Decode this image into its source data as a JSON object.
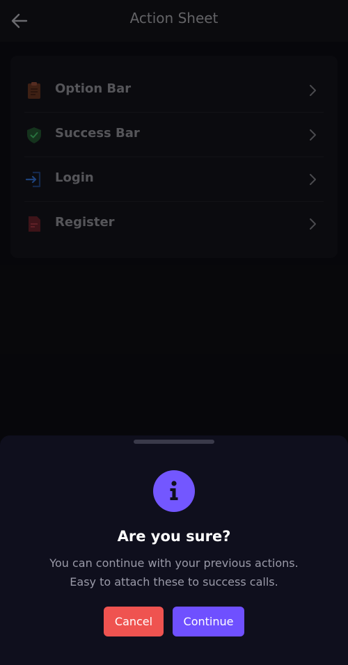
{
  "header": {
    "title": "Action Sheet",
    "back_icon": "arrow-left-icon"
  },
  "menu": {
    "items": [
      {
        "label": "Option Bar",
        "icon": "clipboard-icon",
        "icon_color": "#5a2e1e"
      },
      {
        "label": "Success Bar",
        "icon": "shield-check-icon",
        "icon_color": "#1f4a2a"
      },
      {
        "label": "Login",
        "icon": "login-icon",
        "icon_color": "#1e3a6e"
      },
      {
        "label": "Register",
        "icon": "document-icon",
        "icon_color": "#5a1e24"
      }
    ]
  },
  "sheet": {
    "icon": "info-icon",
    "icon_color": "#7357ff",
    "title": "Are you sure?",
    "message_line1": "You can continue with your previous actions.",
    "message_line2": "Easy to attach these to success calls.",
    "cancel_label": "Cancel",
    "continue_label": "Continue",
    "cancel_color": "#ef5350",
    "continue_color": "#6f50ff"
  }
}
